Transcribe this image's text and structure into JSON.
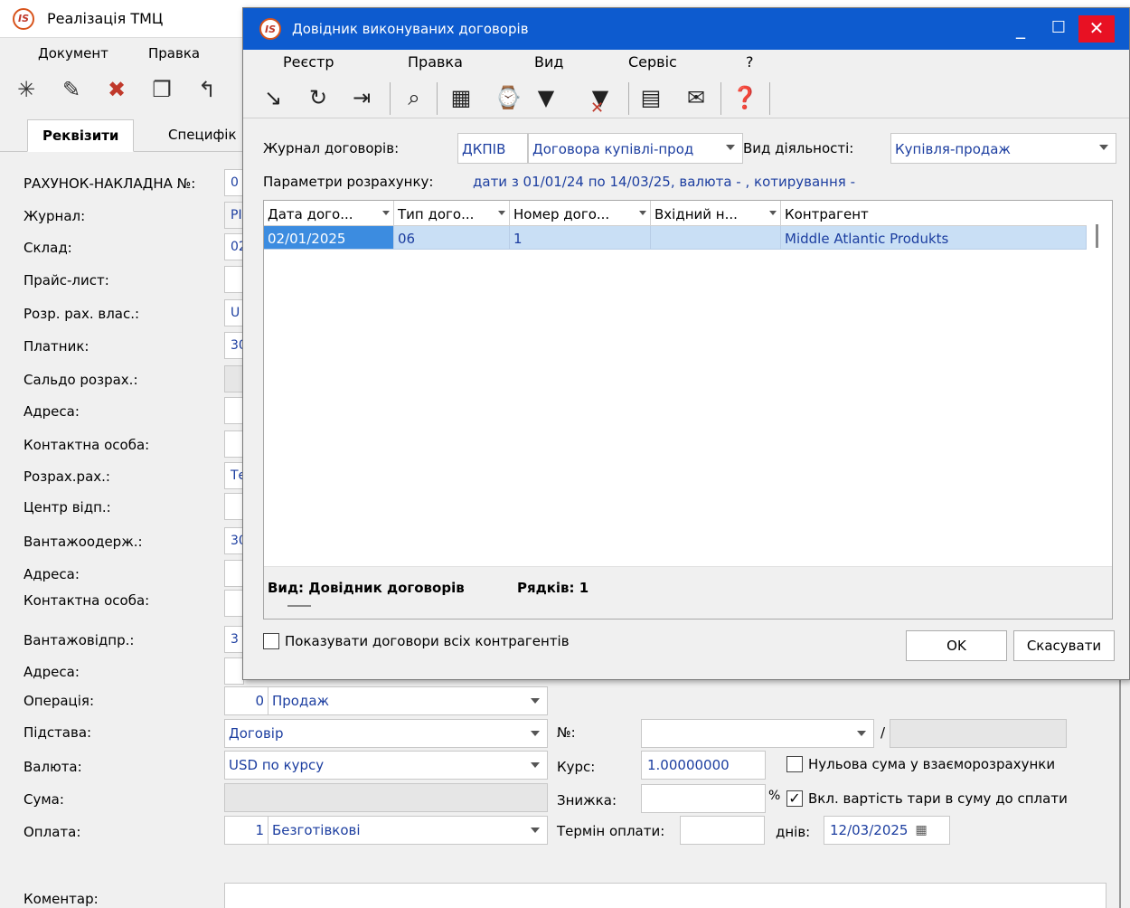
{
  "main": {
    "title": "Реалізація ТМЦ",
    "app_icon": "IS",
    "menu": [
      "Документ",
      "Правка"
    ],
    "tabs": [
      "Реквізити",
      "Специфік"
    ],
    "labels": {
      "invoice_no": "РАХУНОК-НАКЛАДНА №:",
      "journal": "Журнал:",
      "warehouse": "Склад:",
      "price_list": "Прайс-лист:",
      "own_account": "Розр. рах. влас.:",
      "payer": "Платник:",
      "balance": "Сальдо розрах.:",
      "address1": "Адреса:",
      "contact1": "Контактна особа:",
      "settle_account": "Розрах.рах.:",
      "center": "Центр відп.:",
      "consignee": "Вантажоодерж.:",
      "address2": "Адреса:",
      "contact2": "Контактна особа:",
      "shipper": "Вантажовідпр.:",
      "address3": "Адреса:",
      "operation": "Операція:",
      "basis": "Підстава:",
      "currency": "Валюта:",
      "sum": "Сума:",
      "payment": "Оплата:",
      "comment": "Коментар:",
      "number": "№:",
      "rate": "Курс:",
      "discount": "Знижка:",
      "pay_term": "Термін оплати:",
      "days": "днів:",
      "zero_sum": "Нульова сума у взаєморозрахунки",
      "incl_tare": "Вкл. вартість тари в суму до сплати",
      "percent": "%"
    },
    "fields": {
      "invoice_no": "0",
      "journal": "РІ",
      "warehouse": "02",
      "own_account": "U",
      "payer": "30",
      "settle_account": "Те",
      "consignee": "30",
      "shipper": "3",
      "operation_code": "0",
      "operation": "Продаж",
      "basis": "Договір",
      "currency": "USD по курсу",
      "payment_code": "1",
      "payment": "Безготівкові",
      "rate": "1.00000000",
      "pay_date": "12/03/2025",
      "number_sep": "/"
    }
  },
  "dialog": {
    "title": "Довідник виконуваних договорів",
    "menu": [
      "Реєстр",
      "Правка",
      "Вид",
      "Сервіс",
      "?"
    ],
    "journal_label": "Журнал договорів:",
    "journal_code": "ДКПІВ",
    "journal_name": "Договора купівлі-прод",
    "activity_label": "Вид діяльності:",
    "activity_value": "Купівля-продаж",
    "params_label": "Параметри розрахунку:",
    "params_value": "дати з 01/01/24 по 14/03/25, валюта - , котирування -",
    "columns": [
      "Дата дого...",
      "Тип дого...",
      "Номер дого...",
      "Вхідний н...",
      "Контрагент"
    ],
    "rows": [
      [
        "02/01/2025",
        "06",
        "1",
        "",
        "Middle Atlantic Produkts"
      ]
    ],
    "status_view": "Вид: Довідник договорів",
    "status_rows": "Рядків: 1",
    "show_all_label": "Показувати договори всіх контрагентів",
    "ok_label": "OK",
    "cancel_label": "Скасувати"
  },
  "colors": {
    "title_bar": "#0d5bcf",
    "close_button": "#e81123",
    "selected_row": "#c9dff5",
    "link_text": "#1c3ea0"
  }
}
